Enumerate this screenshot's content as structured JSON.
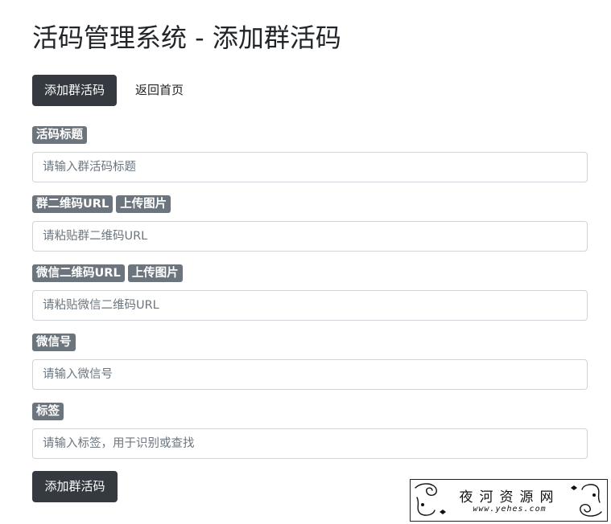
{
  "page": {
    "title": "活码管理系统 - 添加群活码"
  },
  "toolbar": {
    "add_button": "添加群活码",
    "back_link": "返回首页"
  },
  "form": {
    "title_field": {
      "label": "活码标题",
      "placeholder": "请输入群活码标题"
    },
    "group_qr_field": {
      "label": "群二维码URL",
      "upload_label": "上传图片",
      "placeholder": "请粘贴群二维码URL"
    },
    "wechat_qr_field": {
      "label": "微信二维码URL",
      "upload_label": "上传图片",
      "placeholder": "请粘贴微信二维码URL"
    },
    "wechat_id_field": {
      "label": "微信号",
      "placeholder": "请输入微信号"
    },
    "tag_field": {
      "label": "标签",
      "placeholder": "请输入标签，用于识别或查找"
    },
    "submit_label": "添加群活码"
  },
  "watermark": {
    "name": "夜河资源网",
    "url": "www.yehes.com"
  },
  "colors": {
    "dark_button": "#343a40",
    "badge": "#6c757d",
    "input_border": "#ced4da"
  }
}
